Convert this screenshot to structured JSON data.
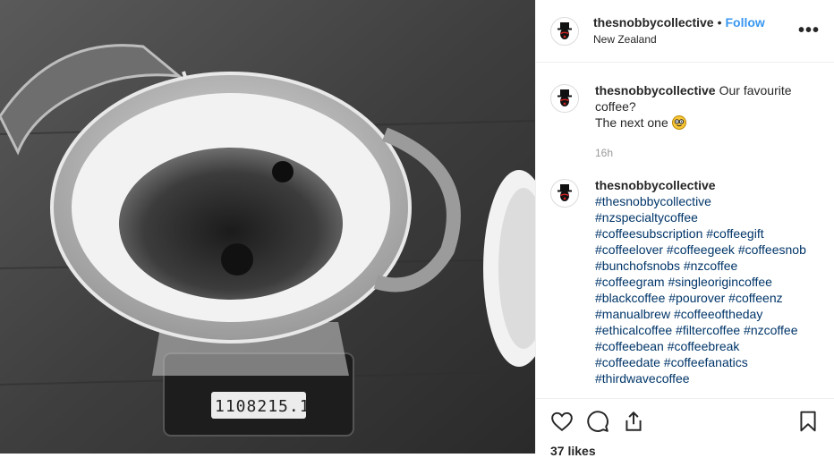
{
  "post": {
    "username": "thesnobbycollective",
    "separator": "•",
    "follow_label": "Follow",
    "location": "New Zealand",
    "more_label": "•••"
  },
  "scale_display": {
    "left": "1108",
    "right": "215.1"
  },
  "caption": {
    "username": "thesnobbycollective",
    "text_line1": "Our favourite coffee?",
    "text_line2": "The next one",
    "emoji_icon": "nerd-face-emoji",
    "time": "16h"
  },
  "comment": {
    "username": "thesnobbycollective",
    "hashtags": [
      "#thesnobbycollective",
      "#nzspecialtycoffee",
      "#coffeesubscription #coffeegift",
      "#coffeelover #coffeegeek #coffeesnob",
      "#bunchofsnobs #nzcoffee",
      "#coffeegram #singleorigincoffee",
      "#blackcoffee #pourover #coffeenz",
      "#manualbrew #coffeeoftheday",
      "#ethicalcoffee #filtercoffee #nzcoffee",
      "#coffeebean #coffeebreak",
      "#coffeedate #coffeefanatics",
      "#thirdwavecoffee"
    ]
  },
  "actions": {
    "icons": [
      "heart-icon",
      "comment-icon",
      "share-icon",
      "bookmark-icon"
    ],
    "likes": "37 likes"
  }
}
